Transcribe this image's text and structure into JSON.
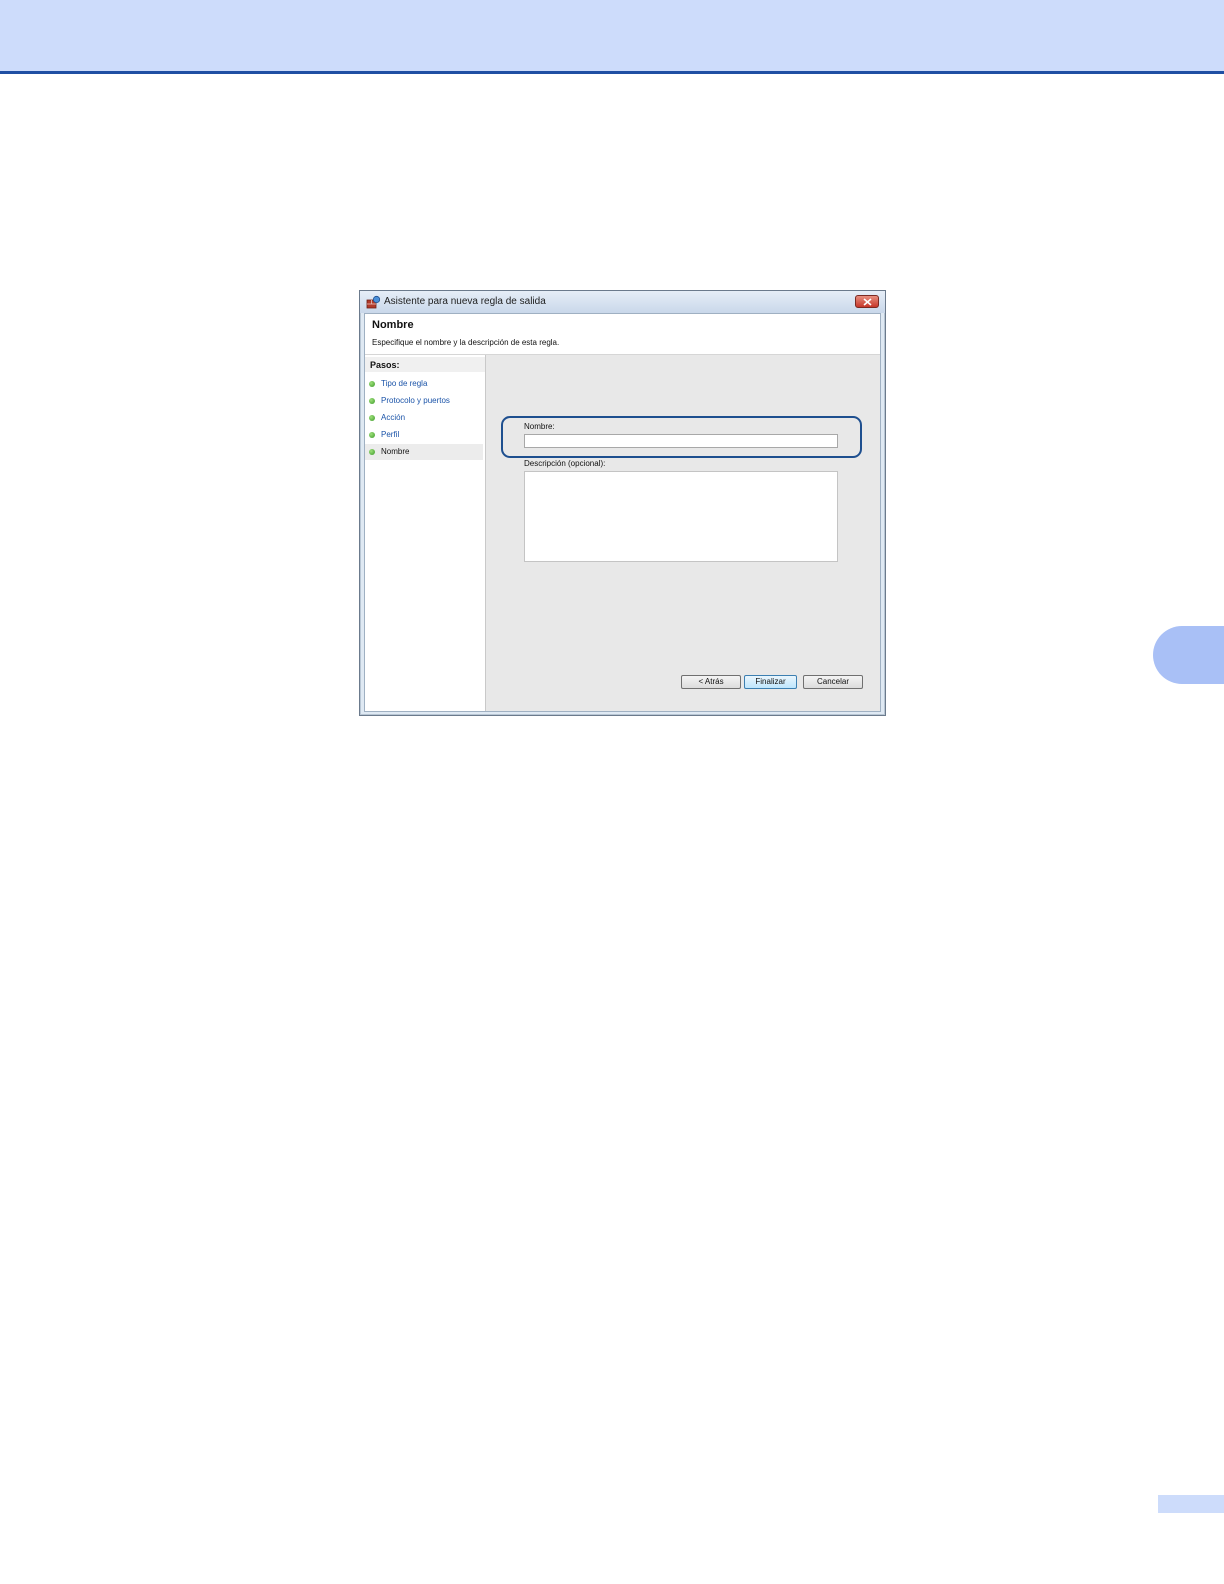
{
  "dialog": {
    "title": "Asistente para nueva regla de salida",
    "heading": "Nombre",
    "subheading": "Especifique el nombre y la descripción de esta regla."
  },
  "steps": {
    "header": "Pasos:",
    "items": [
      {
        "label": "Tipo de regla",
        "active": false
      },
      {
        "label": "Protocolo y puertos",
        "active": false
      },
      {
        "label": "Acción",
        "active": false
      },
      {
        "label": "Perfil",
        "active": false
      },
      {
        "label": "Nombre",
        "active": true
      }
    ]
  },
  "form": {
    "name_label": "Nombre:",
    "name_value": "",
    "description_label": "Descripción (opcional):",
    "description_value": ""
  },
  "buttons": {
    "back": "< Atrás",
    "finish": "Finalizar",
    "cancel": "Cancelar"
  },
  "icons": {
    "app": "firewall-rule-icon",
    "close": "close-icon",
    "step": "green-dot-icon"
  },
  "colors": {
    "header_band": "#cddcfb",
    "header_rule": "#1f4fa3",
    "highlight": "#1e4f8f",
    "link": "#1a53a8"
  }
}
